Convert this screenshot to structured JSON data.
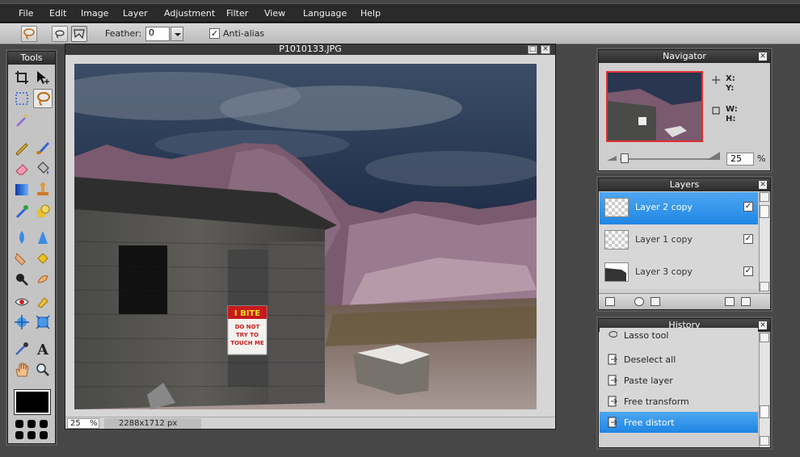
{
  "menu": {
    "items": [
      {
        "label": "File"
      },
      {
        "label": "Edit"
      },
      {
        "label": "Image"
      },
      {
        "label": "Layer"
      },
      {
        "label": "Adjustment"
      },
      {
        "label": "Filter"
      },
      {
        "label": "View"
      },
      {
        "label": "Language"
      },
      {
        "label": "Help"
      }
    ]
  },
  "options": {
    "feather_label": "Feather:",
    "feather_value": "0",
    "antialias_label": "Anti-alias",
    "antialias_checked": true
  },
  "tools": {
    "title": "Tools",
    "active_tool": "lasso",
    "items": [
      "crop-icon",
      "move-icon",
      "marquee-icon",
      "lasso-icon",
      "wand-icon",
      "pencil-icon",
      "brush-icon",
      "eraser-icon",
      "bucket-icon",
      "gradient-icon",
      "stamp-icon",
      "color-replace-icon",
      "shape-icon",
      "blur-icon",
      "sharpen-icon",
      "smudge-icon",
      "sponge-icon",
      "burn-icon",
      "dodge-icon",
      "redeye-icon",
      "bloat-icon",
      "pinch-icon",
      "drag-icon",
      "picker-icon",
      "type-icon",
      "hand-icon",
      "zoom-icon"
    ],
    "foreground_color": "#000000"
  },
  "document": {
    "title": "P1010133.JPG",
    "zoom": "25",
    "zoom_unit": "%",
    "dimensions": "2288x1712 px",
    "sign_line1": "I BITE",
    "sign_line2": "DO NOT",
    "sign_line3": "TRY TO",
    "sign_line4": "TOUCH ME"
  },
  "navigator": {
    "title": "Navigator",
    "x_label": "X:",
    "y_label": "Y:",
    "w_label": "W:",
    "h_label": "H:",
    "zoom": "25",
    "zoom_unit": "%"
  },
  "layers": {
    "title": "Layers",
    "items": [
      {
        "name": "Layer 2 copy",
        "visible": true,
        "selected": true
      },
      {
        "name": "Layer 1 copy",
        "visible": true,
        "selected": false
      },
      {
        "name": "Layer 3 copy",
        "visible": true,
        "selected": false
      }
    ]
  },
  "history": {
    "title": "History",
    "items": [
      {
        "label": "Lasso tool",
        "selected": false
      },
      {
        "label": "Deselect all",
        "selected": false
      },
      {
        "label": "Paste layer",
        "selected": false
      },
      {
        "label": "Free transform",
        "selected": false
      },
      {
        "label": "Free distort",
        "selected": true
      }
    ]
  },
  "colors": {
    "accent": "#2a8ee8",
    "chrome_dark": "#2a2a2a",
    "panel_bg": "#cfcfcf"
  }
}
